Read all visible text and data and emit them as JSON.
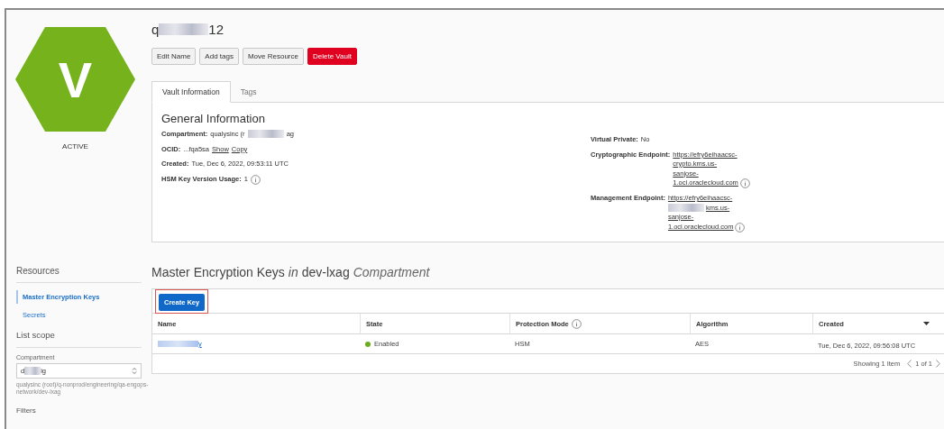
{
  "vault": {
    "status": "ACTIVE",
    "logo_letter": "V",
    "title": [
      {
        "text": "q"
      },
      {
        "kind": "redacted"
      },
      {
        "text": "12"
      }
    ]
  },
  "actions": [
    {
      "label": "Edit Name",
      "kind": "default"
    },
    {
      "label": "Add tags",
      "kind": "default"
    },
    {
      "label": "Move Resource",
      "kind": "default"
    },
    {
      "label": "Delete Vault",
      "kind": "danger"
    }
  ],
  "tabs": [
    {
      "label": "Vault Information",
      "selected": true
    },
    {
      "label": "Tags",
      "selected": false
    }
  ],
  "general_information": {
    "title": "General Information",
    "left": [
      {
        "label": "Compartment:",
        "parts": [
          {
            "text": "qualysinc (r"
          },
          {
            "kind": "redacted"
          },
          {
            "text": "ag"
          }
        ]
      },
      {
        "label": "OCID:",
        "parts": [
          {
            "text": "...fqa5sa"
          }
        ],
        "links": [
          "Show",
          "Copy"
        ]
      },
      {
        "label": "Created:",
        "parts": [
          {
            "text": "Tue, Dec 6, 2022, 09:53:11 UTC"
          }
        ]
      },
      {
        "label": "HSM Key Version Usage:",
        "parts": [
          {
            "text": "1"
          }
        ],
        "info": true
      }
    ],
    "right": [
      {
        "label": "Virtual Private:",
        "parts": [
          {
            "text": "No"
          }
        ]
      },
      {
        "label": "Cryptographic Endpoint:",
        "link_lines": [
          [
            {
              "text": "https://efry6eihaacsc-"
            }
          ],
          [
            {
              "text": "crypto.kms.us-"
            }
          ],
          [
            {
              "text": "sanjose-"
            }
          ],
          [
            {
              "text": "1.oci.oraclecloud.com"
            }
          ]
        ],
        "info": true
      },
      {
        "label": "Management Endpoint:",
        "link_lines": [
          [
            {
              "text": "https://efry6eihaacsc-"
            }
          ],
          [
            {
              "kind": "redacted"
            },
            {
              "text": "kms.us-"
            }
          ],
          [
            {
              "text": "sanjose-"
            }
          ],
          [
            {
              "text": "1.oci.oraclecloud.com"
            }
          ]
        ],
        "info": true
      }
    ]
  },
  "sidebar": {
    "resources_title": "Resources",
    "items": [
      {
        "label": "Master Encryption Keys",
        "selected": true
      },
      {
        "label": "Secrets",
        "selected": false
      }
    ],
    "list_scope_title": "List scope",
    "compartment_label": "Compartment",
    "compartment_value": [
      {
        "text": "d"
      },
      {
        "kind": "redacted"
      },
      {
        "text": "ig"
      }
    ],
    "compartment_path": "qualysinc (root)/q-nonprod/engineering/qa-engops-network/dev-lxag",
    "filters_title": "Filters"
  },
  "keys": {
    "heading": [
      {
        "text": "Master Encryption Keys"
      },
      {
        "text": "in",
        "kind": "emphasis"
      },
      {
        "text": "dev-lxag"
      },
      {
        "text": "Compartment",
        "kind": "emphasis"
      }
    ],
    "create_button": "Create Key",
    "columns": [
      {
        "label": "Name"
      },
      {
        "label": "State"
      },
      {
        "label": "Protection Mode",
        "info": true
      },
      {
        "label": "Algorithm"
      },
      {
        "label": "Created",
        "sort": true
      }
    ],
    "rows": [
      {
        "name": [
          {
            "kind": "redacted"
          },
          {
            "text": "y"
          }
        ],
        "state": "Enabled",
        "color": "#6aad1d",
        "protection_mode": "HSM",
        "algorithm": "AES",
        "created": "Tue, Dec 6, 2022, 09:56:08 UTC"
      }
    ],
    "footer": {
      "showing": "Showing 1 Item",
      "page": "1 of 1"
    }
  }
}
